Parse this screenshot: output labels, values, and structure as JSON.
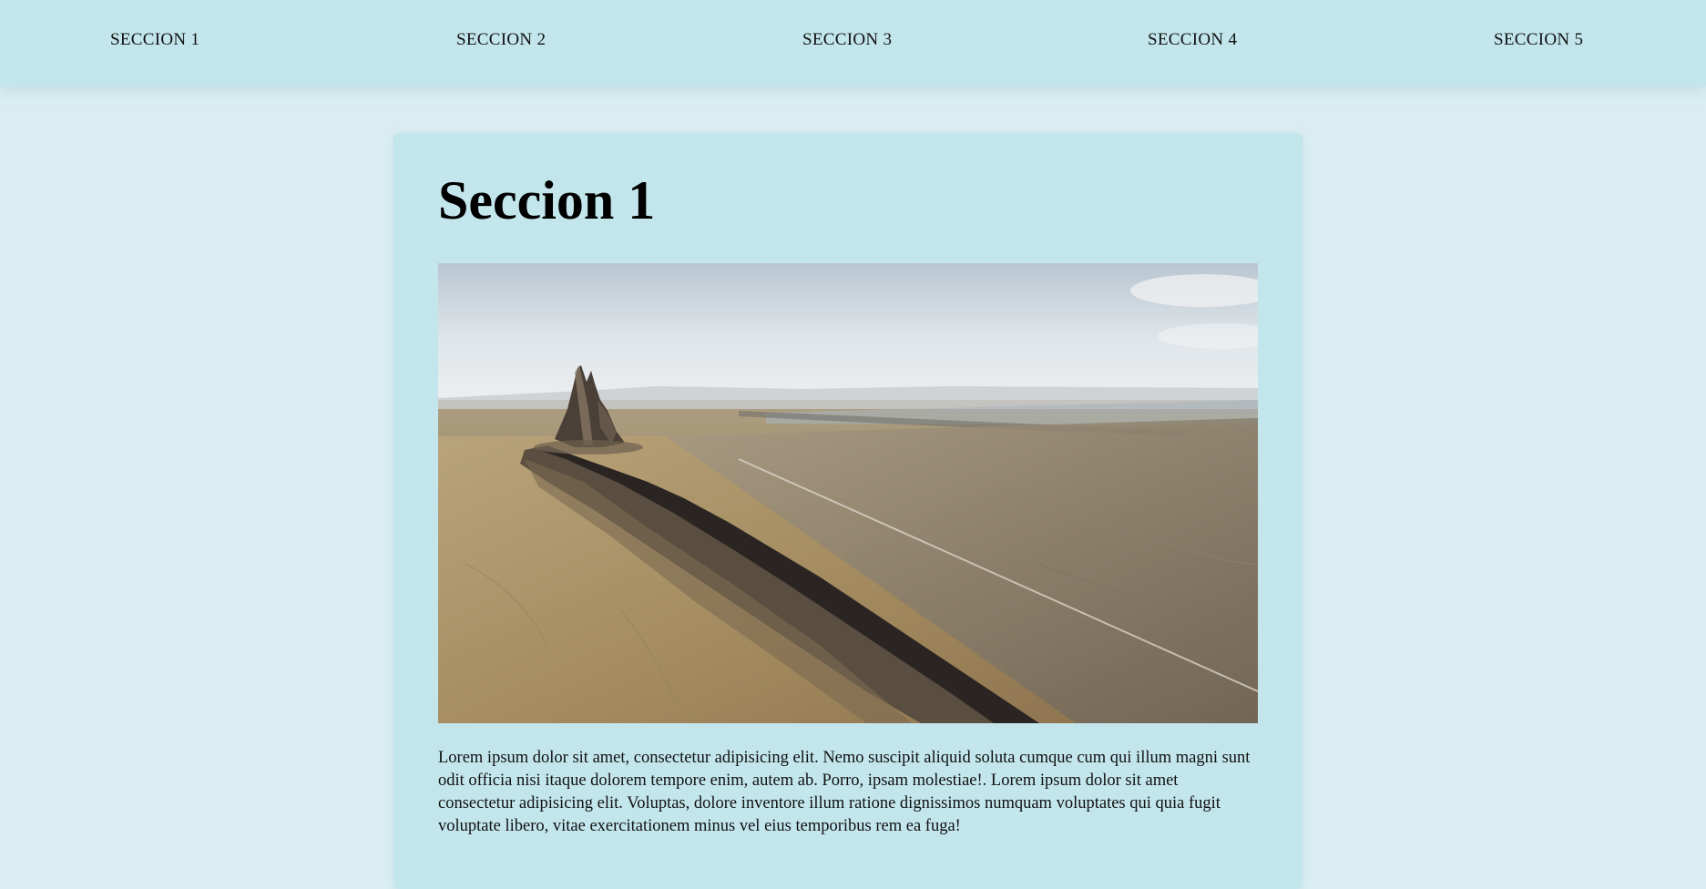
{
  "nav": {
    "items": [
      {
        "label": "SECCION 1"
      },
      {
        "label": "SECCION 2"
      },
      {
        "label": "SECCION 3"
      },
      {
        "label": "SECCION 4"
      },
      {
        "label": "SECCION 5"
      }
    ]
  },
  "section": {
    "title": "Seccion 1",
    "image_subject": "aerial desert landscape with rock pinnacle and long ridge",
    "body": "Lorem ipsum dolor sit amet, consectetur adipisicing elit. Nemo suscipit aliquid soluta cumque cum qui illum magni sunt odit officia nisi itaque dolorem tempore enim, autem ab. Porro, ipsam molestiae!. Lorem ipsum dolor sit amet consectetur adipisicing elit. Voluptas, dolore inventore illum ratione dignissimos numquam voluptates qui quia fugit voluptate libero, vitae exercitationem minus vel eius temporibus rem ea fuga!"
  },
  "colors": {
    "page_background": "#daeef2",
    "nav_background": "#c2e6ec",
    "card_background": "#c3e6ec",
    "text": "#111111"
  }
}
